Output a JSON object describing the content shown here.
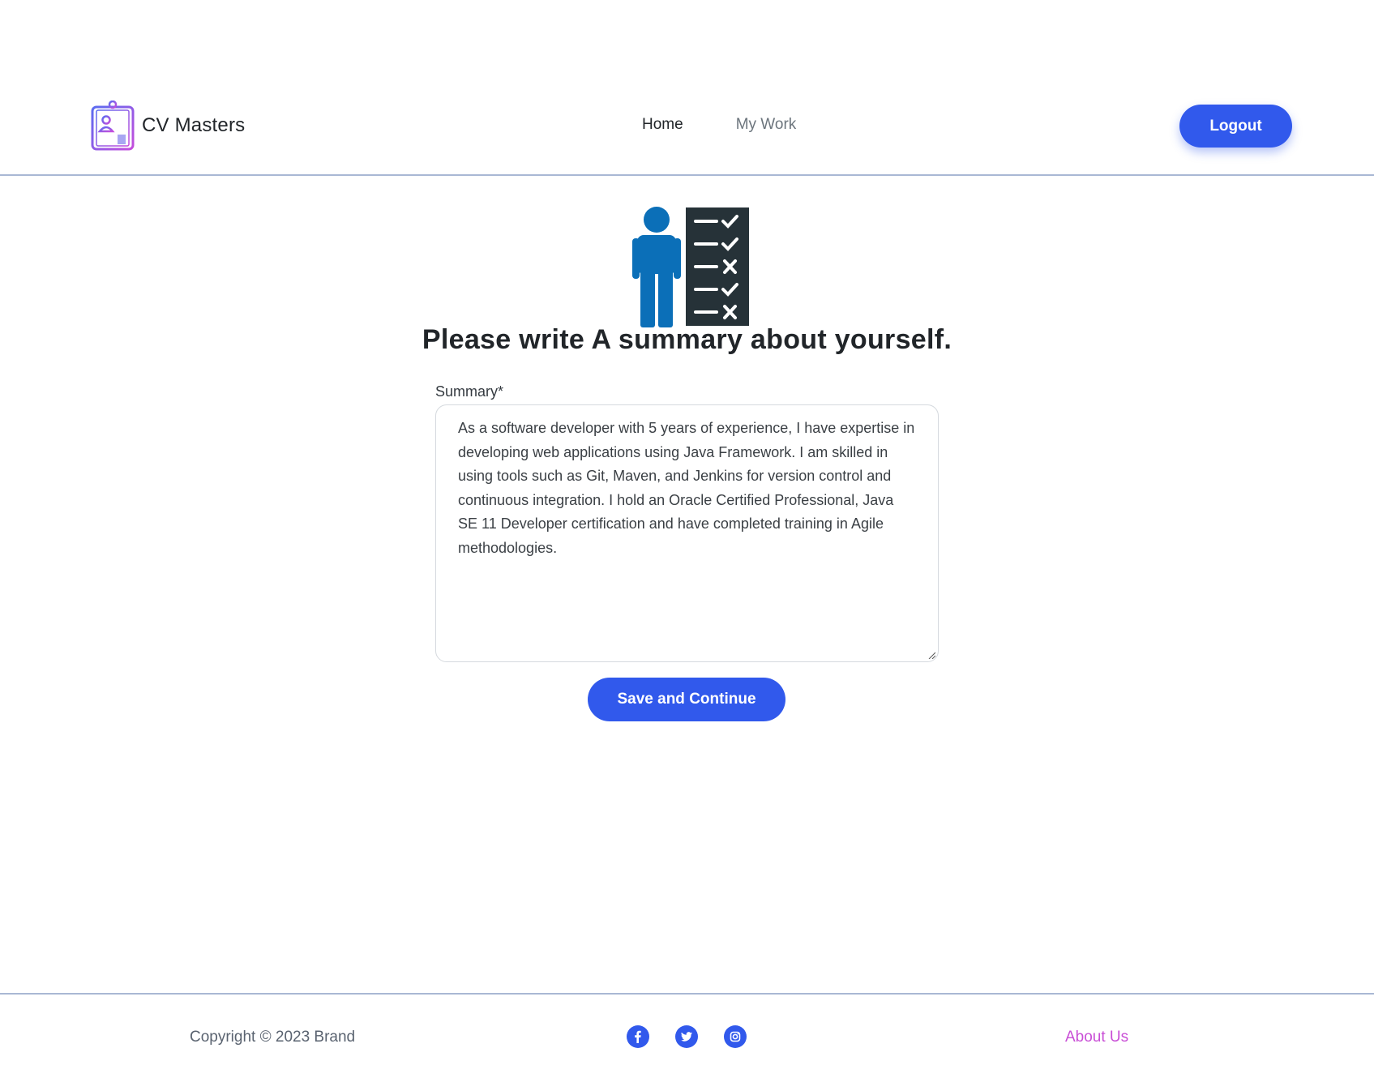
{
  "header": {
    "brand_name": "CV Masters",
    "nav": {
      "home": "Home",
      "my_work": "My Work"
    },
    "logout_label": "Logout"
  },
  "main": {
    "title": "Please write A summary about yourself.",
    "summary_label": "Summary*",
    "summary_value": "As a software developer with 5 years of experience, I have expertise in developing web applications using Java Framework. I am skilled in using tools such as Git, Maven, and Jenkins for version control and continuous integration. I hold an Oracle Certified Professional, Java SE 11 Developer certification and have completed training in Agile methodologies.",
    "save_label": "Save and Continue"
  },
  "footer": {
    "copyright": "Copyright © 2023 Brand",
    "social_icons": [
      "facebook-icon",
      "twitter-icon",
      "instagram-icon"
    ],
    "about_label": "About Us"
  },
  "colors": {
    "primary": "#3159ec",
    "accent_link": "#c94fd6",
    "icon_blue": "#0b6fb8",
    "icon_dark": "#263238"
  }
}
